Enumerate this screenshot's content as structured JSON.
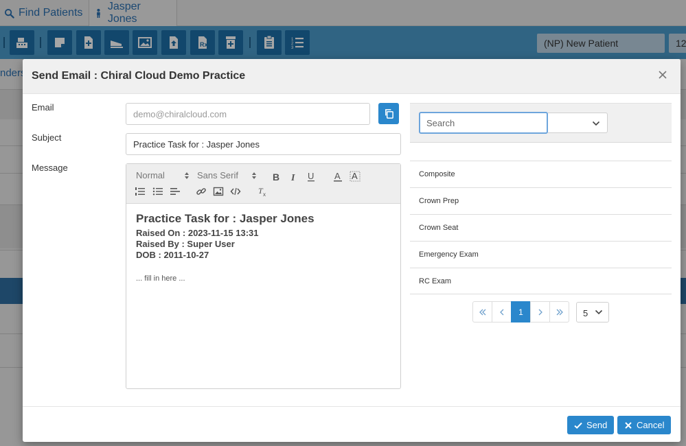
{
  "tabs": [
    {
      "label": "Find Patients",
      "icon": "search-icon"
    },
    {
      "label": "Jasper Jones",
      "icon": "person-icon"
    }
  ],
  "toolbar": {
    "appointment_type": "(NP) New Patient",
    "appointment_number": "12"
  },
  "background": {
    "side_text": "nders"
  },
  "modal": {
    "title": "Send Email : Chiral Cloud Demo Practice",
    "email_label": "Email",
    "email_placeholder": "demo@chiralcloud.com",
    "subject_label": "Subject",
    "subject_value": "Practice Task for : Jasper Jones",
    "message_label": "Message",
    "editor": {
      "format": "Normal",
      "font": "Sans Serif",
      "heading": "Practice Task for : Jasper Jones",
      "raised_on": "Raised On : 2023-11-15 13:31",
      "raised_by": "Raised By : Super User",
      "dob": "DOB : 2011-10-27",
      "fill": "... fill in here ..."
    },
    "templates": {
      "search_placeholder": "Search",
      "items": [
        "Composite",
        "Crown Prep",
        "Crown Seat",
        "Emergency Exam",
        "RC Exam"
      ],
      "current_page": "1",
      "page_size": "5"
    },
    "send_label": "Send",
    "cancel_label": "Cancel"
  },
  "colors": {
    "primary": "#2a87cc",
    "toolbar": "#4a9ac9",
    "toolbar_button": "#1d6ea6"
  }
}
